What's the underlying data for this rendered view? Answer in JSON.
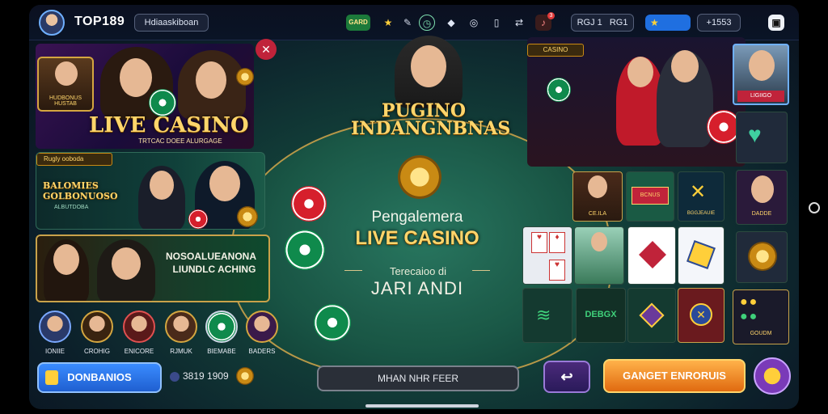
{
  "topbar": {
    "brand": "TOP189",
    "username": "Hdiaaskiboan",
    "status_badge": "GARD",
    "stat_1": "RGJ 1",
    "stat_2": "RG1",
    "stat_3": "+1553",
    "notif_badge": "3",
    "icons": [
      "trophy-icon",
      "pencil-icon",
      "clock-icon",
      "gamepad-icon",
      "chip-icon",
      "card-icon",
      "shuffle-icon",
      "bell-icon",
      "star-icon",
      "dice-icon"
    ]
  },
  "left": {
    "live_casino_banner": {
      "title": "LIVE CASINO",
      "subtitle": "TRTCAC DOEE ALURGAGE",
      "small_card_label": "HUDBONUS HUSTAB"
    },
    "promo1": {
      "tag": "Rugly ooboda",
      "title": "BALOMIES GOLBONUOSO",
      "subtitle": "ALBUTDOBA"
    },
    "promo2": {
      "title": "NOSOALUEANONA",
      "subtitle": "LIUNDLC ACHING"
    },
    "players": [
      {
        "name": "IONIIE"
      },
      {
        "name": "CROHIG"
      },
      {
        "name": "ENICORE"
      },
      {
        "name": "RJMUK"
      },
      {
        "name": "BIEMABE"
      },
      {
        "name": "BADERS"
      }
    ],
    "primary_button": "DONBANIOS",
    "balance": "3819 1909"
  },
  "center": {
    "hero_title": "PUGINO INDANGNBNAS",
    "welcome_line1": "Pengalemera",
    "welcome_title": "LIVE CASINO",
    "welcome_sub": "Terecaioo di",
    "welcome_big": "JARI ANDI",
    "input_button": "MHAN NHR FEER"
  },
  "right": {
    "table_label": "CASINO",
    "grid": [
      {
        "label": "CE.ILA"
      },
      {
        "label": "BCNUS"
      },
      {
        "label": "BGGJEAUIE"
      }
    ],
    "row3_label": "DEBGX",
    "side": [
      {
        "label": "LIGIIGO"
      },
      {
        "label": ""
      },
      {
        "label": "DADDE"
      },
      {
        "label": ""
      },
      {
        "label": "GOUDM"
      }
    ],
    "cta_button": "GANGET ENRORUIS"
  },
  "colors": {
    "accent_gold": "#ffd56b",
    "felt": "#1d5a4a",
    "cta_orange": "#f28a1c",
    "primary_blue": "#1f6fe0"
  }
}
